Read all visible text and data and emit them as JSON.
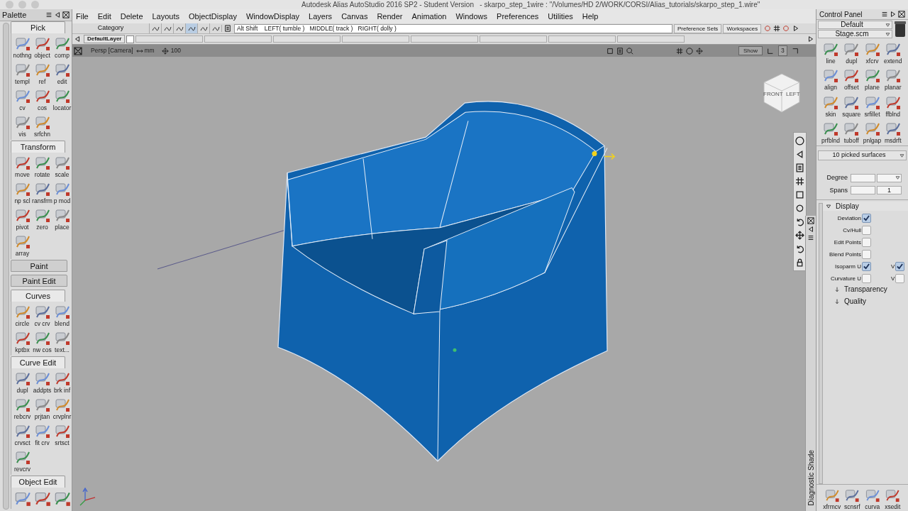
{
  "window": {
    "title": "Autodesk Alias AutoStudio 2016 SP2 - Student Version   - skarpo_step_1wire : \"/Volumes/HD 2/WORK/CORSI/Alias_tutorials/skarpo_step_1.wire\""
  },
  "palette": {
    "title": "Palette",
    "sections": [
      {
        "title": "Pick",
        "expanded": true,
        "tools": [
          {
            "label": "nothng"
          },
          {
            "label": "object"
          },
          {
            "label": "comp"
          },
          {
            "label": "templ"
          },
          {
            "label": "ref"
          },
          {
            "label": "edit"
          },
          {
            "label": "cv"
          },
          {
            "label": "cos"
          },
          {
            "label": "locator"
          },
          {
            "label": "vis"
          },
          {
            "label": "srfchn"
          }
        ]
      },
      {
        "title": "Transform",
        "expanded": true,
        "tools": [
          {
            "label": "move"
          },
          {
            "label": "rotate"
          },
          {
            "label": "scale"
          },
          {
            "label": "np scl"
          },
          {
            "label": "ransfrm"
          },
          {
            "label": "p mod"
          },
          {
            "label": "pivot"
          },
          {
            "label": "zero"
          },
          {
            "label": "place"
          },
          {
            "label": "array"
          }
        ]
      },
      {
        "title": "Paint",
        "expanded": false
      },
      {
        "title": "Paint Edit",
        "expanded": false
      },
      {
        "title": "Curves",
        "expanded": true,
        "tools": [
          {
            "label": "circle"
          },
          {
            "label": "cv crv"
          },
          {
            "label": "blend"
          },
          {
            "label": "kptbx"
          },
          {
            "label": "nw cos"
          },
          {
            "label": "text..."
          }
        ]
      },
      {
        "title": "Curve Edit",
        "expanded": true,
        "tools": [
          {
            "label": "dupl"
          },
          {
            "label": "addpts"
          },
          {
            "label": "brk inf"
          },
          {
            "label": "rebcrv"
          },
          {
            "label": "prjtan"
          },
          {
            "label": "crvplnr"
          },
          {
            "label": "crvsct"
          },
          {
            "label": "fit crv"
          },
          {
            "label": "srtsct"
          },
          {
            "label": "revcrv"
          }
        ]
      },
      {
        "title": "Object Edit",
        "expanded": true,
        "tools": [
          {
            "kind": "icon_only"
          },
          {
            "kind": "icon_only"
          },
          {
            "kind": "icon_only"
          }
        ]
      }
    ]
  },
  "menu": [
    "File",
    "Edit",
    "Delete",
    "Layouts",
    "ObjectDisplay",
    "WindowDisplay",
    "Layers",
    "Canvas",
    "Render",
    "Animation",
    "Windows",
    "Preferences",
    "Utilities",
    "Help"
  ],
  "toolbar": {
    "category_label": "Category",
    "mode_buttons": [
      {
        "selected": false
      },
      {
        "selected": false
      },
      {
        "selected": false
      },
      {
        "selected": true
      },
      {
        "selected": false
      },
      {
        "selected": false
      }
    ],
    "hint": "Alt Shift    LEFT( tumble )   MIDDLE( track )   RIGHT( dolly )",
    "buttons": [
      "Preference Sets",
      "Workspaces"
    ]
  },
  "layers": {
    "default_layer": "DefaultLayer"
  },
  "viewport": {
    "camera": "Persp [Camera]",
    "units": "mm",
    "grid": "100",
    "show_button": "Show",
    "view_count": "3",
    "view_cube": {
      "front": "FRONT",
      "left": "LEFT"
    }
  },
  "diagnostic": {
    "title": "Diagnostic Shade"
  },
  "control_panel": {
    "title": "Control Panel",
    "preset": "Default",
    "stage": "Stage.scm",
    "tools": [
      "line",
      "dupl",
      "xfcrv",
      "extend",
      "align",
      "offset",
      "plane",
      "planar",
      "skin",
      "square",
      "srfillet",
      "ffblnd",
      "prfblnd",
      "tuboff",
      "pnlgap",
      "msdrft"
    ],
    "selection": "10 picked surfaces",
    "degree": {
      "label": "Degree"
    },
    "spans": {
      "label": "Spans",
      "value": "1"
    },
    "display": {
      "title": "Display",
      "expanded": true,
      "options": [
        {
          "label": "Deviation",
          "checked": true
        },
        {
          "label": "Cv/Hull",
          "checked": false
        },
        {
          "label": "Edit Points",
          "checked": false
        },
        {
          "label": "Blend Points",
          "checked": false
        },
        {
          "label": "Isoparm U",
          "checked": true,
          "v": {
            "label": "V",
            "checked": true
          }
        },
        {
          "label": "Curvature U",
          "checked": false,
          "v": {
            "label": "V",
            "checked": false
          }
        }
      ]
    },
    "subsections": [
      {
        "title": "Transparency",
        "expanded": false
      },
      {
        "title": "Quality",
        "expanded": false
      }
    ],
    "shelf": [
      "xfrmcv",
      "scnsrf",
      "curva",
      "xsedit"
    ]
  }
}
